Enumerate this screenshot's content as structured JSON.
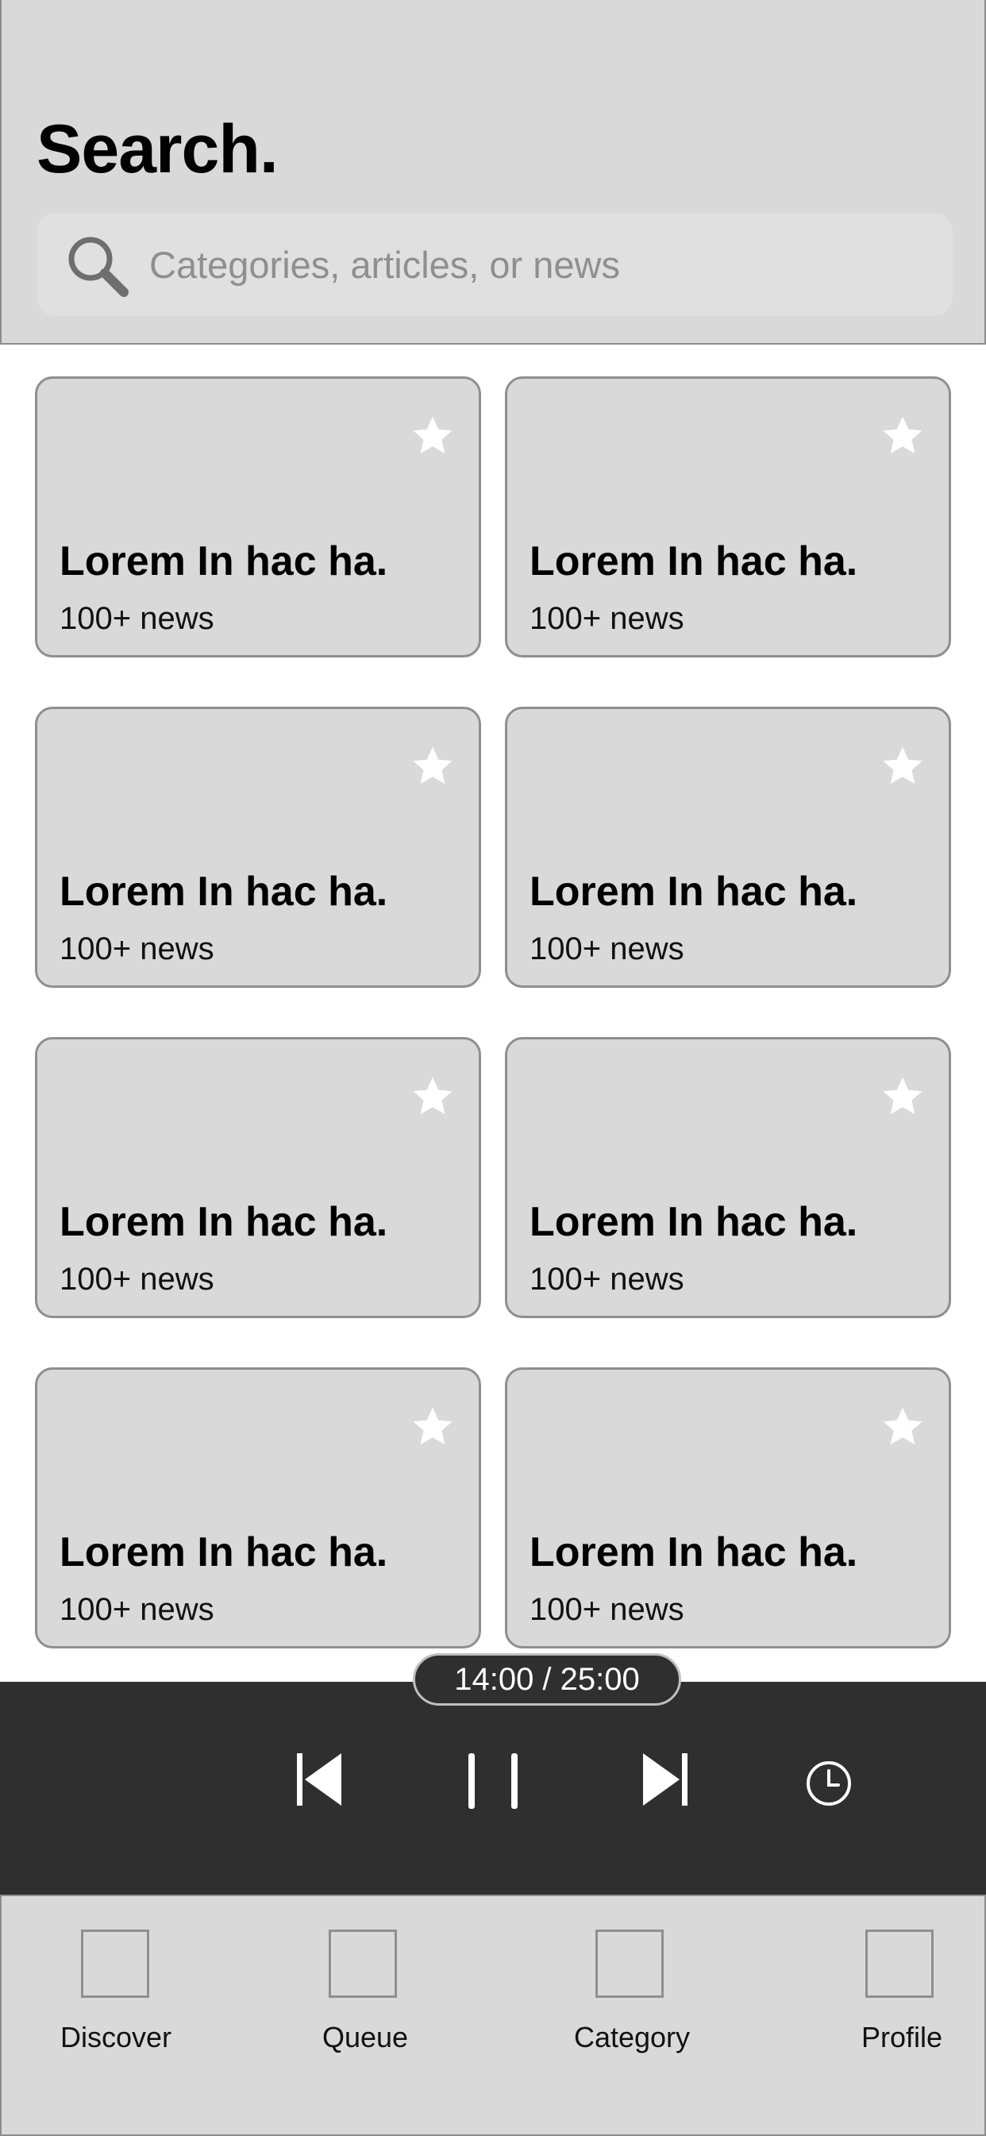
{
  "header": {
    "title": "Search.",
    "search_placeholder": "Categories, articles, or news"
  },
  "cards": [
    {
      "title": "Lorem In hac ha.",
      "subtitle": "100+ news"
    },
    {
      "title": "Lorem In hac ha.",
      "subtitle": "100+ news"
    },
    {
      "title": "Lorem In hac ha.",
      "subtitle": "100+ news"
    },
    {
      "title": "Lorem In hac ha.",
      "subtitle": "100+ news"
    },
    {
      "title": "Lorem In hac ha.",
      "subtitle": "100+ news"
    },
    {
      "title": "Lorem In hac ha.",
      "subtitle": "100+ news"
    },
    {
      "title": "Lorem In hac ha.",
      "subtitle": "100+ news"
    },
    {
      "title": "Lorem In hac ha.",
      "subtitle": "100+ news"
    }
  ],
  "player": {
    "time": "14:00 / 25:00",
    "icons": [
      "skip-previous-icon",
      "pause-icon",
      "skip-next-icon",
      "clock-icon"
    ]
  },
  "nav": {
    "items": [
      {
        "label": "Discover"
      },
      {
        "label": "Queue"
      },
      {
        "label": "Category"
      },
      {
        "label": "Profile"
      }
    ]
  },
  "colors": {
    "panel": "#d9d9d9",
    "border": "#8f8f8f",
    "player_bg": "#2f2f2f",
    "placeholder": "#8f8f8f"
  }
}
